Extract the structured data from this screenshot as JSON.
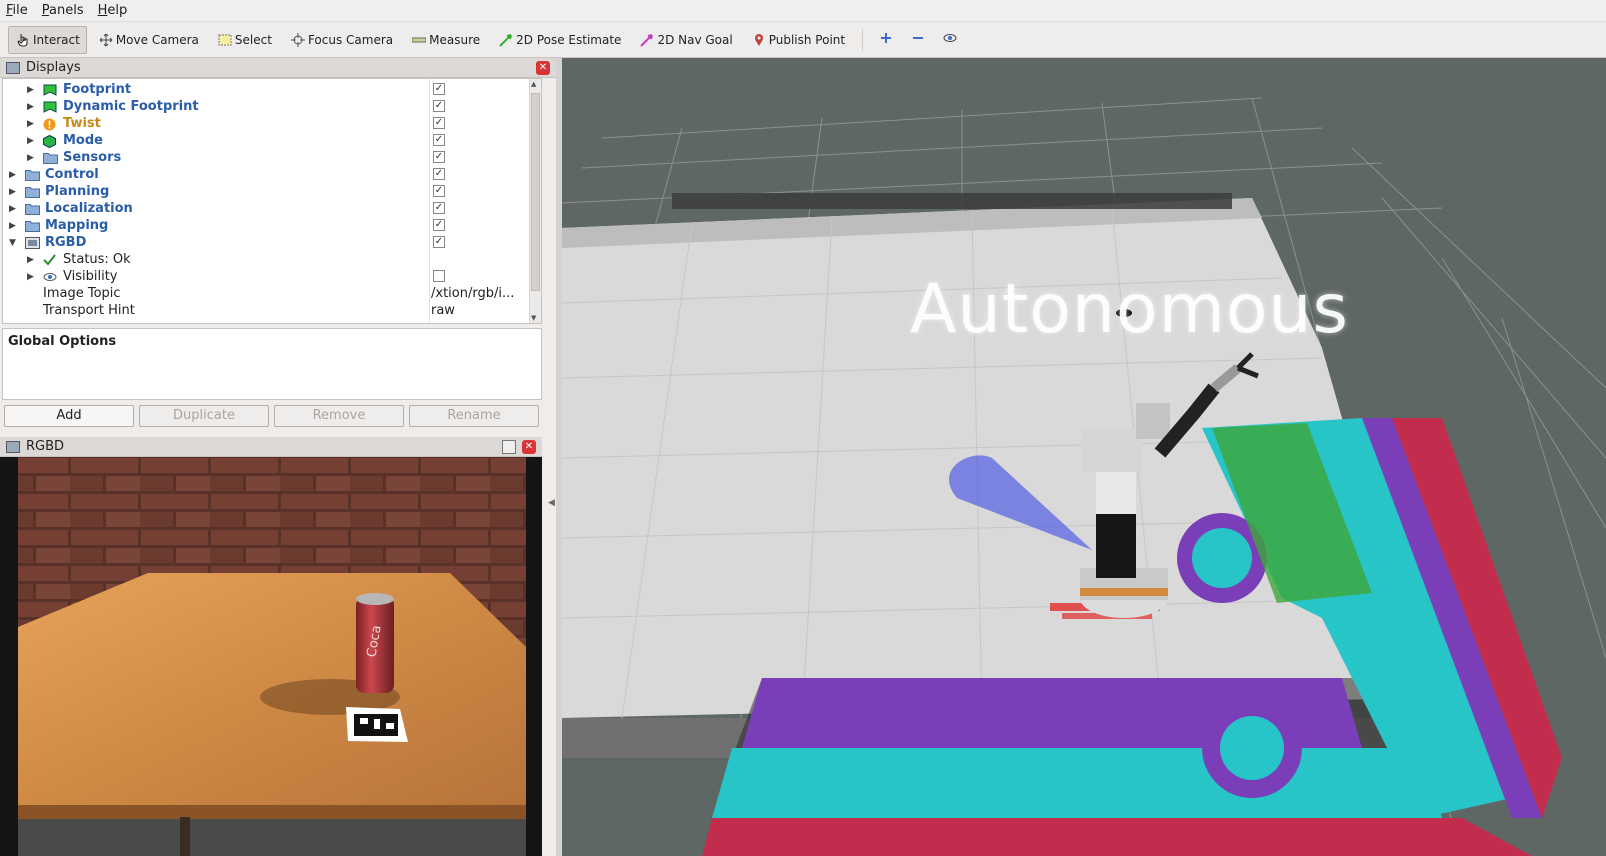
{
  "menu": {
    "file": "File",
    "panels": "Panels",
    "help": "Help"
  },
  "toolbar": {
    "interact": "Interact",
    "move_camera": "Move Camera",
    "select": "Select",
    "focus_camera": "Focus Camera",
    "measure": "Measure",
    "pose_estimate": "2D Pose Estimate",
    "nav_goal": "2D Nav Goal",
    "publish_point": "Publish Point"
  },
  "displays": {
    "title": "Displays",
    "items": [
      {
        "label": "Footprint",
        "checked": "✓"
      },
      {
        "label": "Dynamic Footprint",
        "checked": "✓"
      },
      {
        "label": "Twist",
        "checked": "✓"
      },
      {
        "label": "Mode",
        "checked": "✓"
      },
      {
        "label": "Sensors",
        "checked": "✓"
      },
      {
        "label": "Control",
        "checked": "✓"
      },
      {
        "label": "Planning",
        "checked": "✓"
      },
      {
        "label": "Localization",
        "checked": "✓"
      },
      {
        "label": "Mapping",
        "checked": "✓"
      },
      {
        "label": "RGBD",
        "checked": "✓"
      },
      {
        "label": "Status: Ok"
      },
      {
        "label": "Visibility",
        "checked": ""
      },
      {
        "label": "Image Topic",
        "value": "/xtion/rgb/i..."
      },
      {
        "label": "Transport Hint",
        "value": "raw"
      }
    ]
  },
  "global_options": "Global Options",
  "buttons": {
    "add": "Add",
    "duplicate": "Duplicate",
    "remove": "Remove",
    "rename": "Rename"
  },
  "rgbd_panel": {
    "title": "RGBD"
  },
  "view": {
    "overlay": "Autonomous"
  },
  "colors": {
    "link_blue": "#2a5da8",
    "warn_orange": "#c78a16",
    "close_red": "#d8343a",
    "costmap_cyan": "#27c4c8",
    "costmap_purple": "#7a3fb8",
    "obstacle_green": "#3fa83a"
  }
}
